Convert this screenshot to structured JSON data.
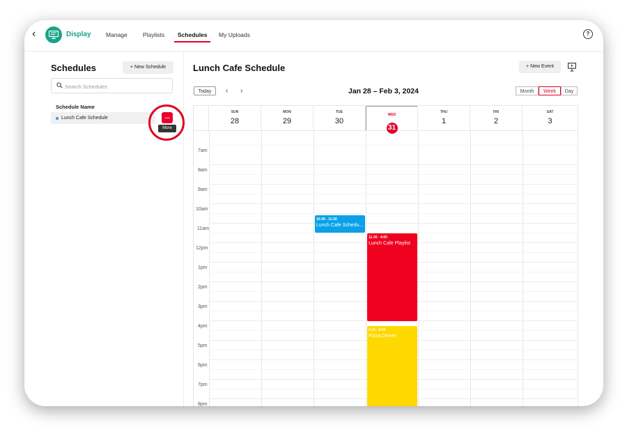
{
  "topbar": {
    "back_icon": "chevron-left-icon",
    "brand": "Display",
    "nav": [
      "Manage",
      "Playlists",
      "Schedules",
      "My Uploads"
    ],
    "active_nav": "Schedules",
    "help_glyph": "?"
  },
  "sidebar": {
    "title": "Schedules",
    "new_button": "+ New Schedule",
    "search_placeholder": "Search Schedules",
    "column_header": "Schedule Name",
    "items": [
      {
        "name": "Lunch Cafe Schedule"
      }
    ],
    "more_button": "...",
    "tooltip": "More"
  },
  "main": {
    "title": "Lunch Cafe Schedule",
    "new_event_button": "+ New Event",
    "today_button": "Today",
    "prev": "‹",
    "next": "›",
    "range": "Jan 28 – Feb 3, 2024",
    "views": [
      "Month",
      "Week",
      "Day"
    ],
    "active_view": "Week"
  },
  "calendar": {
    "days": [
      {
        "dow": "SUN",
        "num": "28"
      },
      {
        "dow": "MON",
        "num": "29"
      },
      {
        "dow": "TUE",
        "num": "30"
      },
      {
        "dow": "WED",
        "num": "31"
      },
      {
        "dow": "THU",
        "num": "1"
      },
      {
        "dow": "FRI",
        "num": "2"
      },
      {
        "dow": "SAT",
        "num": "3"
      }
    ],
    "today_index": 3,
    "hours": [
      "7am",
      "8am",
      "9am",
      "10am",
      "11am",
      "12pm",
      "1pm",
      "2pm",
      "3pm",
      "4pm",
      "5pm",
      "6pm",
      "7pm",
      "8pm"
    ],
    "events": [
      {
        "time": "10:36 - 11:30",
        "title": "Lunch Cafe Schedu...",
        "color": "#0aa1e8"
      },
      {
        "time": "11:30 - 4:00",
        "title": "Lunch Cafe Playlist",
        "color": "#f0001f"
      },
      {
        "time": "4:15 - 8:00",
        "title": "Pizza Dinner",
        "color": "#ffd800"
      }
    ]
  },
  "colors": {
    "accent": "#e3002b",
    "brand": "#1aa389"
  }
}
